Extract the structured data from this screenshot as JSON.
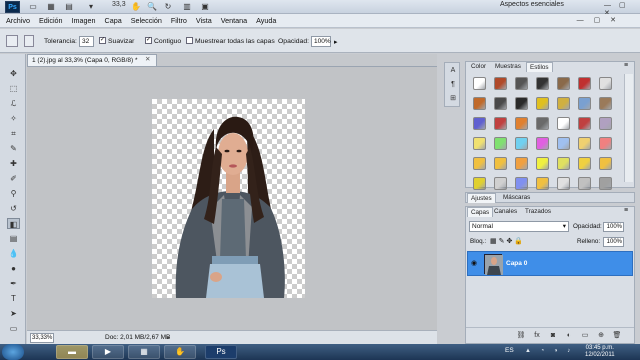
{
  "app": {
    "logo": "Ps",
    "zoom": "33,3",
    "workspace": "Aspectos esenciales",
    "window_controls": "— ▢ ✕"
  },
  "menu": [
    "Archivo",
    "Edición",
    "Imagen",
    "Capa",
    "Selección",
    "Filtro",
    "Vista",
    "Ventana",
    "Ayuda"
  ],
  "menu_right": "— ▢ ✕",
  "options": {
    "tolerance_label": "Tolerancia:",
    "tolerance_value": "32",
    "smooth_label": "Suavizar",
    "contiguous_label": "Contiguo",
    "sample_all_label": "Muestrear todas las capas",
    "opacity_label": "Opacidad:",
    "opacity_value": "100%"
  },
  "document": {
    "tab_title": "1 (2).jpg al 33,3% (Capa 0, RGB/8) *",
    "close": "✕",
    "zoom_status": "33,33%",
    "doc_status": "Doc: 2,01 MB/2,67 MB"
  },
  "styles_panel": {
    "tabs": [
      "Color",
      "Muestras",
      "Estilos"
    ],
    "active_tab": "Estilos",
    "swatch_colors": [
      "#ffffff",
      "#b04a2a",
      "#555555",
      "#333333",
      "#8a6a4a",
      "#c03030",
      "#e0e0e0",
      "#c06a2a",
      "#4a4a4a",
      "#2a2a2a",
      "#e0c020",
      "#d0b040",
      "#7aa0d0",
      "#9a7a5a",
      "#6060d0",
      "#c04040",
      "#e08030",
      "#6a6a6a",
      "#ffffff",
      "#c04040",
      "#b0a0c0",
      "#f0e070",
      "#80e070",
      "#70d0f0",
      "#e060e0",
      "#a0c0f0",
      "#f0d070",
      "#f08080",
      "#f0c040",
      "#f0c040",
      "#f0a040",
      "#f0f040",
      "#e0e060",
      "#f0d040",
      "#f0c040",
      "#e0d030",
      "#d0d0d0",
      "#8090f0",
      "#f0c040",
      "#e0e0e0",
      "#c0c0c0",
      "#a0a0a0"
    ]
  },
  "adjust_tabs": [
    "Ajustes",
    "Máscaras"
  ],
  "layers_panel": {
    "tabs": [
      "Capas",
      "Canales",
      "Trazados"
    ],
    "blend_mode": "Normal",
    "opacity_label": "Opacidad:",
    "opacity_value": "100%",
    "lock_label": "Bloq.:",
    "fill_label": "Relleno:",
    "fill_value": "100%",
    "layer_name": "Capa 0"
  },
  "taskbar": {
    "language": "ES",
    "time": "03:45 p.m.",
    "date": "12/02/2011"
  }
}
